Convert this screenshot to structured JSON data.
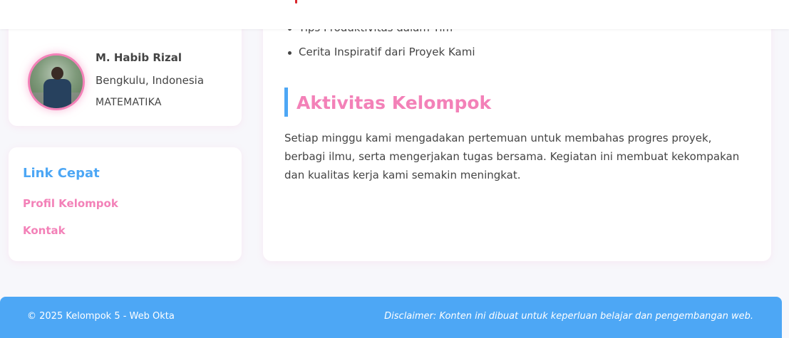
{
  "profile": {
    "name": "M. Habib Rizal",
    "location": "Bengkulu, Indonesia",
    "major": "MATEMATIKA"
  },
  "quick_links": {
    "title": "Link Cepat",
    "items": [
      {
        "label": "Profil Kelompok"
      },
      {
        "label": "Kontak"
      }
    ]
  },
  "main": {
    "bullets": [
      {
        "text": "Tips Produktivitas dalam Tim"
      },
      {
        "text": "Cerita Inspiratif dari Proyek Kami"
      }
    ],
    "section_title": "Aktivitas Kelompok",
    "section_text": "Setiap minggu kami mengadakan pertemuan untuk membahas progres proyek, berbagi ilmu, serta mengerjakan tugas bersama. Kegiatan ini membuat kekompakan dan kualitas kerja kami semakin meningkat."
  },
  "footer": {
    "copyright": "© 2025 Kelompok 5 - Web Okta",
    "disclaimer": "Disclaimer: Konten ini dibuat untuk keperluan belajar dan pengembangan web."
  },
  "colors": {
    "accent_blue": "#4da7f5",
    "accent_pink": "#f381b8",
    "page_bg": "#f7f7fb"
  }
}
